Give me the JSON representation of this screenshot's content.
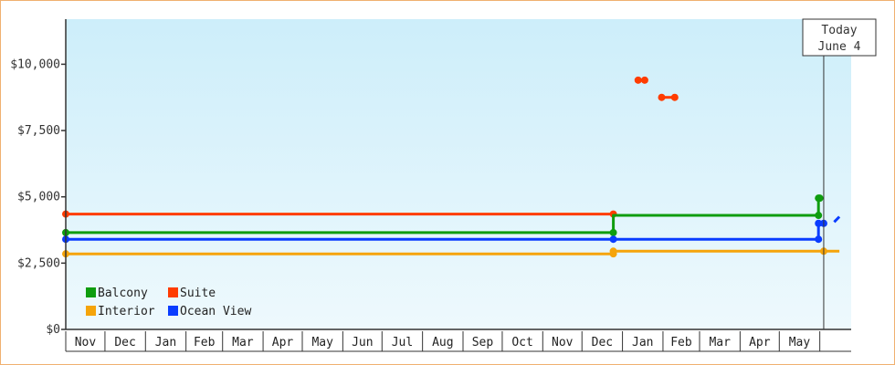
{
  "chart_data": {
    "type": "line",
    "title": "",
    "xlabel": "",
    "ylabel": "",
    "ylim": [
      0,
      11700
    ],
    "y_ticks": [
      0,
      2500,
      5000,
      7500,
      10000
    ],
    "y_tick_labels": [
      "$0",
      "$2,500",
      "$5,000",
      "$7,500",
      "$10,000"
    ],
    "x_range": [
      "2021-11-01",
      "2023-06-25"
    ],
    "months": [
      "Nov",
      "Dec",
      "Jan",
      "Feb",
      "Mar",
      "Apr",
      "May",
      "Jun",
      "Jul",
      "Aug",
      "Sep",
      "Oct",
      "Nov",
      "Dec",
      "Jan",
      "Feb",
      "Mar",
      "Apr",
      "May"
    ],
    "today": {
      "line1": "Today",
      "line2": "June 4",
      "date": "2023-06-04"
    },
    "grid": false,
    "background": {
      "top": "#cdeefa",
      "bottom": "#eef9fd"
    },
    "legend": {
      "placement": "bottom-left",
      "entries": [
        {
          "label": "Balcony",
          "color": "#0f9d0f"
        },
        {
          "label": "Suite",
          "color": "#ff3c00"
        },
        {
          "label": "Interior",
          "color": "#f5a40a"
        },
        {
          "label": "Ocean View",
          "color": "#0a3cff"
        }
      ]
    },
    "series": [
      {
        "name": "Suite",
        "color": "#ff3c00",
        "segments": [
          [
            [
              "2021-11-01",
              4350
            ],
            [
              "2022-12-25",
              4350
            ]
          ],
          [
            [
              "2023-01-13",
              9400
            ],
            [
              "2023-01-18",
              9400
            ]
          ],
          [
            [
              "2023-01-31",
              8750
            ],
            [
              "2023-02-10",
              8750
            ]
          ]
        ],
        "points": [
          [
            "2021-11-01",
            4350
          ],
          [
            "2022-12-25",
            4350
          ],
          [
            "2023-01-13",
            9400
          ],
          [
            "2023-01-18",
            9400
          ],
          [
            "2023-01-31",
            8750
          ],
          [
            "2023-02-10",
            8750
          ]
        ]
      },
      {
        "name": "Balcony",
        "color": "#0f9d0f",
        "segments": [
          [
            [
              "2021-11-01",
              3650
            ],
            [
              "2022-12-25",
              3650
            ],
            [
              "2022-12-25",
              4300
            ],
            [
              "2023-05-31",
              4300
            ],
            [
              "2023-05-31",
              4950
            ],
            [
              "2023-06-01",
              4950
            ]
          ]
        ],
        "points": [
          [
            "2021-11-01",
            3650
          ],
          [
            "2022-12-25",
            3650
          ],
          [
            "2023-05-31",
            4300
          ],
          [
            "2023-05-31",
            4950
          ],
          [
            "2023-06-01",
            4950
          ]
        ]
      },
      {
        "name": "Ocean View",
        "color": "#0a3cff",
        "segments": [
          [
            [
              "2021-11-01",
              3400
            ],
            [
              "2023-05-31",
              3400
            ],
            [
              "2023-05-31",
              4000
            ],
            [
              "2023-06-04",
              4000
            ]
          ],
          [
            [
              "2023-06-12",
              4050
            ],
            [
              "2023-06-16",
              4250
            ]
          ]
        ],
        "points": [
          [
            "2021-11-01",
            3400
          ],
          [
            "2022-12-25",
            3400
          ],
          [
            "2023-05-31",
            3400
          ],
          [
            "2023-05-31",
            4000
          ],
          [
            "2023-06-04",
            4000
          ]
        ]
      },
      {
        "name": "Interior",
        "color": "#f5a40a",
        "segments": [
          [
            [
              "2021-11-01",
              2850
            ],
            [
              "2022-12-25",
              2850
            ],
            [
              "2022-12-25",
              2950
            ],
            [
              "2023-06-04",
              2950
            ],
            [
              "2023-06-16",
              2950
            ]
          ]
        ],
        "points": [
          [
            "2021-11-01",
            2850
          ],
          [
            "2022-12-25",
            2850
          ],
          [
            "2022-12-25",
            2950
          ],
          [
            "2023-06-04",
            2950
          ]
        ]
      }
    ]
  }
}
